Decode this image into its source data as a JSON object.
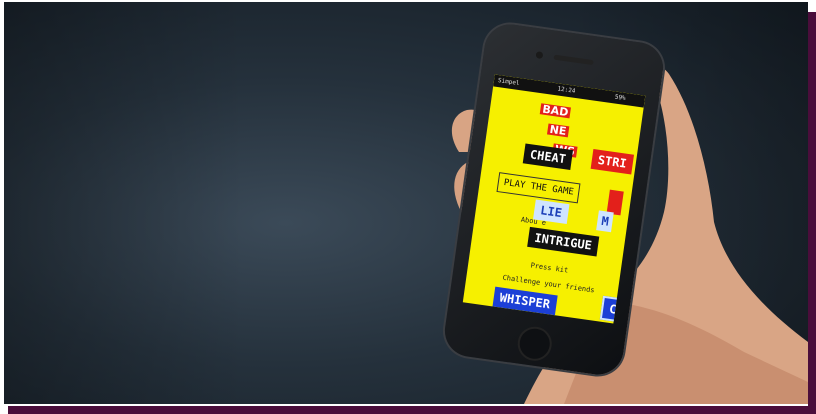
{
  "phone": {
    "status_carrier": "Simpel",
    "status_time": "12:24",
    "status_battery": "59%"
  },
  "app": {
    "logo_line1": "BAD",
    "logo_line2": "NE",
    "logo_line3": "WS",
    "tile_cheat": "CHEAT",
    "tile_strike": "STRI",
    "play_button": "PLAY THE GAME",
    "tile_lie": "LIE",
    "tile_m": "M",
    "tile_intrigue": "INTRIGUE",
    "about_text": "Abou  e",
    "press_kit": "Press kit",
    "challenge_text": "Challenge your friends",
    "tile_whisper": "WHISPER",
    "tile_co": "CO"
  },
  "colors": {
    "screen_yellow": "#f6f000",
    "accent_red": "#e3201b",
    "accent_blue": "#1c3fd6",
    "frame_shadow": "#4a0d3b"
  }
}
